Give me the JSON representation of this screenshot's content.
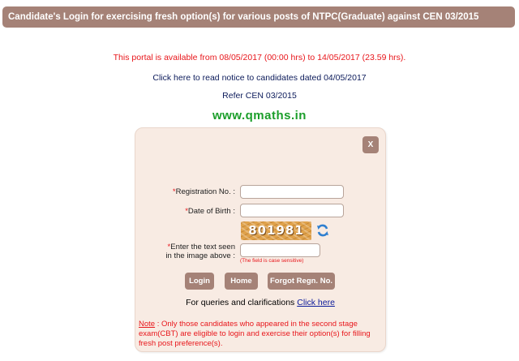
{
  "header": {
    "title": "Candidate's Login for exercising fresh option(s) for various posts of NTPC(Graduate) against CEN 03/2015"
  },
  "notices": {
    "portal": "This portal is available from 08/05/2017 (00:00 hrs) to 14/05/2017 (23.59 hrs).",
    "read_notice": "Click here to read notice to candidates dated 04/05/2017",
    "refer": "Refer CEN 03/2015"
  },
  "watermark": "www.qmaths.in",
  "login": {
    "close_label": "X",
    "required_mark": "*",
    "registration_label": "Registration No. :",
    "registration_value": "",
    "dob_label": "Date of Birth :",
    "dob_value": "",
    "captcha_text": "801981",
    "captcha_label_line1": "Enter the text seen",
    "captcha_label_line2": "in the image above :",
    "captcha_value": "",
    "case_hint": "(The field is case sensitive)",
    "buttons": {
      "login": "Login",
      "home": "Home",
      "forgot": "Forgot Regn. No."
    },
    "queries_text": "For queries and clarifications",
    "queries_link": "Click here",
    "note_title": "Note",
    "note_text": ": Only those candidates who appeared in the second stage exam(CBT) are eligible to login and exercise their option(s) for filling fresh post preference(s)."
  },
  "colors": {
    "header_bg": "#a58277",
    "panel_bg": "#f8ebe3",
    "alert_red": "#e8161b",
    "watermark_green": "#1b9e2a",
    "link_blue": "#0b1a9a"
  },
  "icons": {
    "refresh": "refresh-icon",
    "close": "close-icon"
  }
}
